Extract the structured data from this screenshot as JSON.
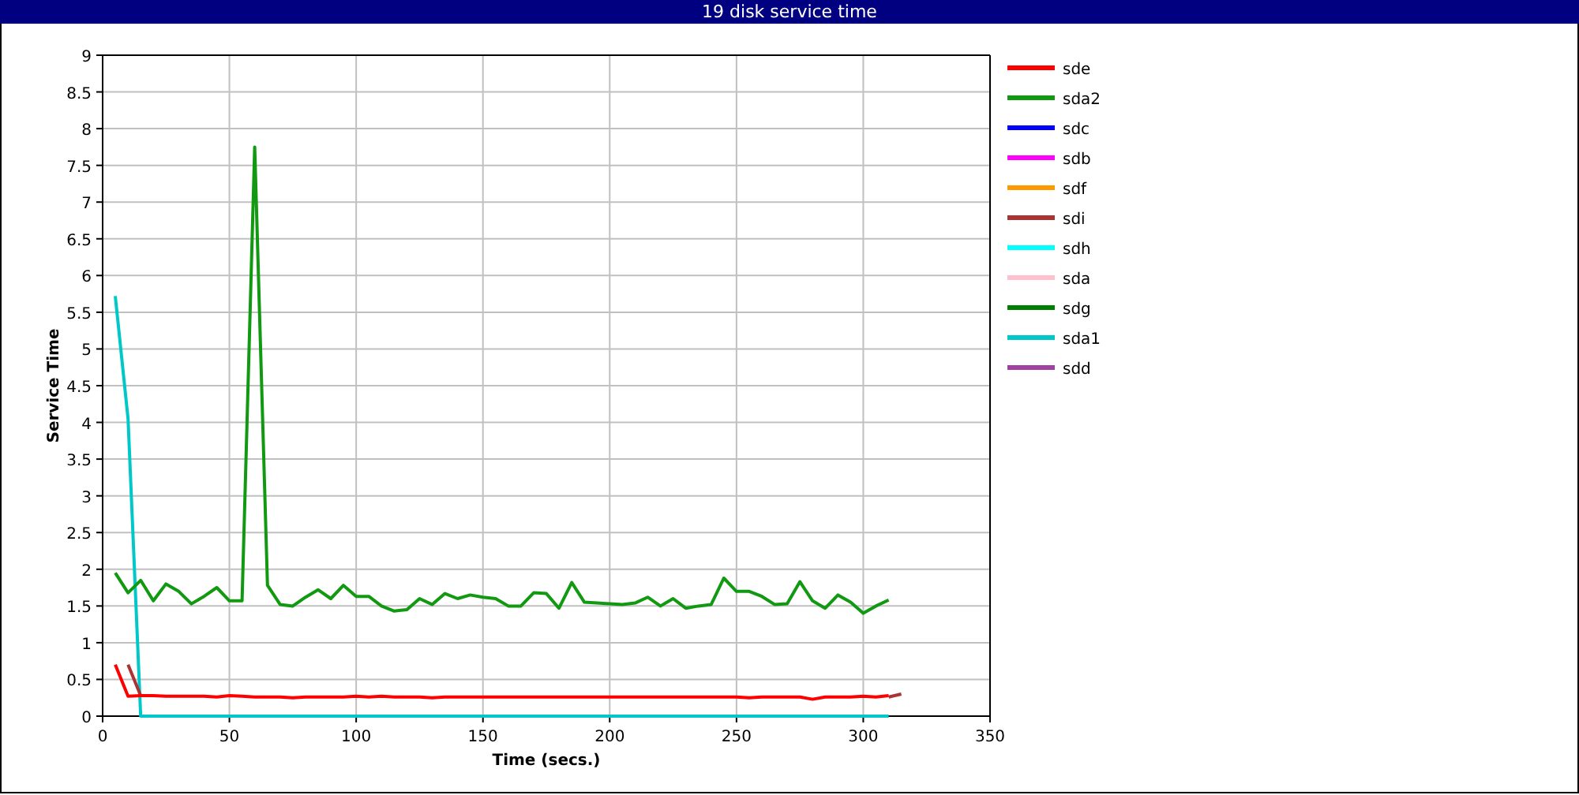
{
  "chart_data": {
    "type": "line",
    "title": "19 disk service time",
    "xlabel": "Time (secs.)",
    "ylabel": "Service Time",
    "xlim": [
      0,
      350
    ],
    "ylim": [
      0,
      9
    ],
    "grid": true,
    "legend": true,
    "xticks": [
      0,
      50,
      100,
      150,
      200,
      250,
      300,
      350
    ],
    "yticks": [
      0,
      0.5,
      1,
      1.5,
      2,
      2.5,
      3,
      3.5,
      4,
      4.5,
      5,
      5.5,
      6,
      6.5,
      7,
      7.5,
      8,
      8.5,
      9
    ],
    "x": [
      5,
      10,
      15,
      20,
      25,
      30,
      35,
      40,
      45,
      50,
      55,
      60,
      65,
      70,
      75,
      80,
      85,
      90,
      95,
      100,
      105,
      110,
      115,
      120,
      125,
      130,
      135,
      140,
      145,
      150,
      155,
      160,
      165,
      170,
      175,
      180,
      185,
      190,
      195,
      200,
      205,
      210,
      215,
      220,
      225,
      230,
      235,
      240,
      245,
      250,
      255,
      260,
      265,
      270,
      275,
      280,
      285,
      290,
      295,
      300,
      305,
      310,
      315
    ],
    "series": [
      {
        "name": "sde",
        "color": "#ff0000",
        "values": [
          0.7,
          0.27,
          0.28,
          0.28,
          0.27,
          0.27,
          0.27,
          0.27,
          0.26,
          0.28,
          0.27,
          0.26,
          0.26,
          0.26,
          0.25,
          0.26,
          0.26,
          0.26,
          0.26,
          0.27,
          0.26,
          0.27,
          0.26,
          0.26,
          0.26,
          0.25,
          0.26,
          0.26,
          0.26,
          0.26,
          0.26,
          0.26,
          0.26,
          0.26,
          0.26,
          0.26,
          0.26,
          0.26,
          0.26,
          0.26,
          0.26,
          0.26,
          0.26,
          0.26,
          0.26,
          0.26,
          0.26,
          0.26,
          0.26,
          0.26,
          0.25,
          0.26,
          0.26,
          0.26,
          0.26,
          0.23,
          0.26,
          0.26,
          0.26,
          0.27,
          0.26,
          0.28,
          null
        ]
      },
      {
        "name": "sda2",
        "color": "#119911",
        "values": [
          1.95,
          1.68,
          1.85,
          1.57,
          1.8,
          1.7,
          1.53,
          1.63,
          1.75,
          1.57,
          1.57,
          7.75,
          1.78,
          1.52,
          1.5,
          1.62,
          1.72,
          1.6,
          1.78,
          1.63,
          1.63,
          1.5,
          1.43,
          1.45,
          1.6,
          1.52,
          1.67,
          1.6,
          1.65,
          1.62,
          1.6,
          1.5,
          1.5,
          1.68,
          1.67,
          1.47,
          1.82,
          1.55,
          1.54,
          1.53,
          1.52,
          1.54,
          1.62,
          1.5,
          1.6,
          1.47,
          1.5,
          1.52,
          1.88,
          1.7,
          1.7,
          1.63,
          1.52,
          1.53,
          1.83,
          1.57,
          1.47,
          1.65,
          1.55,
          1.4,
          1.5,
          1.58,
          null
        ]
      },
      {
        "name": "sdc",
        "color": "#0000ff",
        "values": [
          null,
          null,
          null,
          null,
          null,
          null,
          null,
          null,
          null,
          null,
          null,
          null,
          null,
          null,
          null,
          null,
          null,
          null,
          null,
          null,
          null,
          null,
          null,
          null,
          null,
          null,
          null,
          null,
          null,
          null,
          null,
          null,
          null,
          null,
          null,
          null,
          null,
          null,
          null,
          null,
          null,
          null,
          null,
          null,
          null,
          null,
          null,
          null,
          null,
          null,
          null,
          null,
          null,
          null,
          null,
          null,
          null,
          null,
          null,
          null,
          null,
          null,
          null
        ]
      },
      {
        "name": "sdb",
        "color": "#ff00ff",
        "values": [
          null,
          null,
          null,
          null,
          null,
          null,
          null,
          null,
          null,
          null,
          null,
          null,
          null,
          null,
          null,
          null,
          null,
          null,
          null,
          null,
          null,
          null,
          null,
          null,
          null,
          null,
          null,
          null,
          null,
          null,
          null,
          null,
          null,
          null,
          null,
          null,
          null,
          null,
          null,
          null,
          null,
          null,
          null,
          null,
          null,
          null,
          null,
          null,
          null,
          null,
          null,
          null,
          null,
          null,
          null,
          null,
          null,
          null,
          null,
          null,
          null,
          null,
          null
        ]
      },
      {
        "name": "sdf",
        "color": "#ff9900",
        "values": [
          null,
          null,
          null,
          null,
          null,
          null,
          null,
          null,
          null,
          null,
          null,
          null,
          null,
          null,
          null,
          null,
          null,
          null,
          null,
          null,
          null,
          null,
          null,
          null,
          null,
          null,
          null,
          null,
          null,
          null,
          null,
          null,
          null,
          null,
          null,
          null,
          null,
          null,
          null,
          null,
          null,
          null,
          null,
          null,
          null,
          null,
          null,
          null,
          null,
          null,
          null,
          null,
          null,
          null,
          null,
          null,
          null,
          null,
          null,
          null,
          null,
          null,
          null
        ]
      },
      {
        "name": "sdi",
        "color": "#aa3333",
        "values": [
          null,
          0.7,
          0.28,
          null,
          null,
          null,
          null,
          null,
          null,
          null,
          null,
          null,
          null,
          null,
          null,
          null,
          null,
          null,
          null,
          null,
          null,
          null,
          null,
          null,
          null,
          null,
          null,
          null,
          null,
          null,
          null,
          null,
          null,
          null,
          null,
          null,
          null,
          null,
          null,
          null,
          null,
          null,
          null,
          null,
          null,
          null,
          null,
          null,
          null,
          null,
          null,
          null,
          null,
          null,
          null,
          null,
          null,
          null,
          null,
          null,
          null,
          0.26,
          0.3
        ]
      },
      {
        "name": "sdh",
        "color": "#00ffff",
        "values": [
          null,
          null,
          null,
          null,
          null,
          null,
          null,
          null,
          null,
          null,
          null,
          null,
          null,
          null,
          null,
          null,
          null,
          null,
          null,
          null,
          null,
          null,
          null,
          null,
          null,
          null,
          null,
          null,
          null,
          null,
          null,
          null,
          null,
          null,
          null,
          null,
          null,
          null,
          null,
          null,
          null,
          null,
          null,
          null,
          null,
          null,
          null,
          null,
          null,
          null,
          null,
          null,
          null,
          null,
          null,
          null,
          null,
          null,
          null,
          null,
          null,
          null,
          null
        ]
      },
      {
        "name": "sda",
        "color": "#ffc0cb",
        "values": [
          null,
          null,
          null,
          null,
          null,
          null,
          null,
          null,
          null,
          null,
          null,
          null,
          null,
          null,
          null,
          null,
          null,
          null,
          null,
          null,
          null,
          null,
          null,
          null,
          null,
          null,
          null,
          null,
          null,
          null,
          null,
          null,
          null,
          null,
          null,
          null,
          null,
          null,
          null,
          null,
          null,
          null,
          null,
          null,
          null,
          null,
          null,
          null,
          null,
          null,
          null,
          null,
          null,
          null,
          null,
          null,
          null,
          null,
          null,
          null,
          null,
          null,
          null
        ]
      },
      {
        "name": "sdg",
        "color": "#008000",
        "values": [
          null,
          null,
          null,
          null,
          null,
          null,
          null,
          null,
          null,
          null,
          null,
          null,
          null,
          null,
          null,
          null,
          null,
          null,
          null,
          null,
          null,
          null,
          null,
          null,
          null,
          null,
          null,
          null,
          null,
          null,
          null,
          null,
          null,
          null,
          null,
          null,
          null,
          null,
          null,
          null,
          null,
          null,
          null,
          null,
          null,
          null,
          null,
          null,
          null,
          null,
          null,
          null,
          null,
          null,
          null,
          null,
          null,
          null,
          null,
          null,
          null,
          null,
          null
        ]
      },
      {
        "name": "sda1",
        "color": "#00c8c8",
        "values": [
          5.72,
          4.05,
          0,
          0,
          0,
          0,
          0,
          0,
          0,
          0,
          0,
          0,
          0,
          0,
          0,
          0,
          0,
          0,
          0,
          0,
          0,
          0,
          0,
          0,
          0,
          0,
          0,
          0,
          0,
          0,
          0,
          0,
          0,
          0,
          0,
          0,
          0,
          0,
          0,
          0,
          0,
          0,
          0,
          0,
          0,
          0,
          0,
          0,
          0,
          0,
          0,
          0,
          0,
          0,
          0,
          0,
          0,
          0,
          0,
          0,
          0,
          0,
          null
        ]
      },
      {
        "name": "sdd",
        "color": "#a040a0",
        "values": [
          null,
          null,
          null,
          null,
          null,
          null,
          null,
          null,
          null,
          null,
          null,
          null,
          null,
          null,
          null,
          null,
          null,
          null,
          null,
          null,
          null,
          null,
          null,
          null,
          null,
          null,
          null,
          null,
          null,
          null,
          null,
          null,
          null,
          null,
          null,
          null,
          null,
          null,
          null,
          null,
          null,
          null,
          null,
          null,
          null,
          null,
          null,
          null,
          null,
          null,
          null,
          null,
          null,
          null,
          null,
          null,
          null,
          null,
          null,
          null,
          null,
          null,
          null
        ]
      }
    ]
  }
}
